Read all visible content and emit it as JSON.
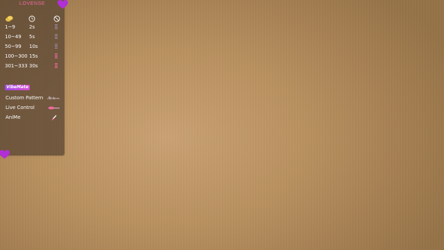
{
  "panel": {
    "brand": "LOVENSE",
    "header_icons": [
      "tokens-icon",
      "clock-icon",
      "intensity-icon"
    ],
    "tip_levels": [
      {
        "range": "1~9",
        "duration": "2s",
        "level": 1
      },
      {
        "range": "10~49",
        "duration": "5s",
        "level": 2
      },
      {
        "range": "50~99",
        "duration": "10s",
        "level": 3
      },
      {
        "range": "100~300",
        "duration": "15s",
        "level": 4
      },
      {
        "range": "301~333",
        "duration": "30s",
        "level": 5
      }
    ],
    "vibemate_label": "VibeMate",
    "features": [
      {
        "label": "Custom Pattern",
        "icon": "waveform-icon"
      },
      {
        "label": "Live Control",
        "icon": "toy-icon"
      },
      {
        "label": "AniMe",
        "icon": "brush-icon"
      }
    ]
  },
  "colors": {
    "accent": "#f06aa0",
    "heart": "#b12fd6",
    "panel_bg": "#5c4834",
    "vibemate_gradient_start": "#a04be6",
    "vibemate_gradient_end": "#d64fd0"
  }
}
